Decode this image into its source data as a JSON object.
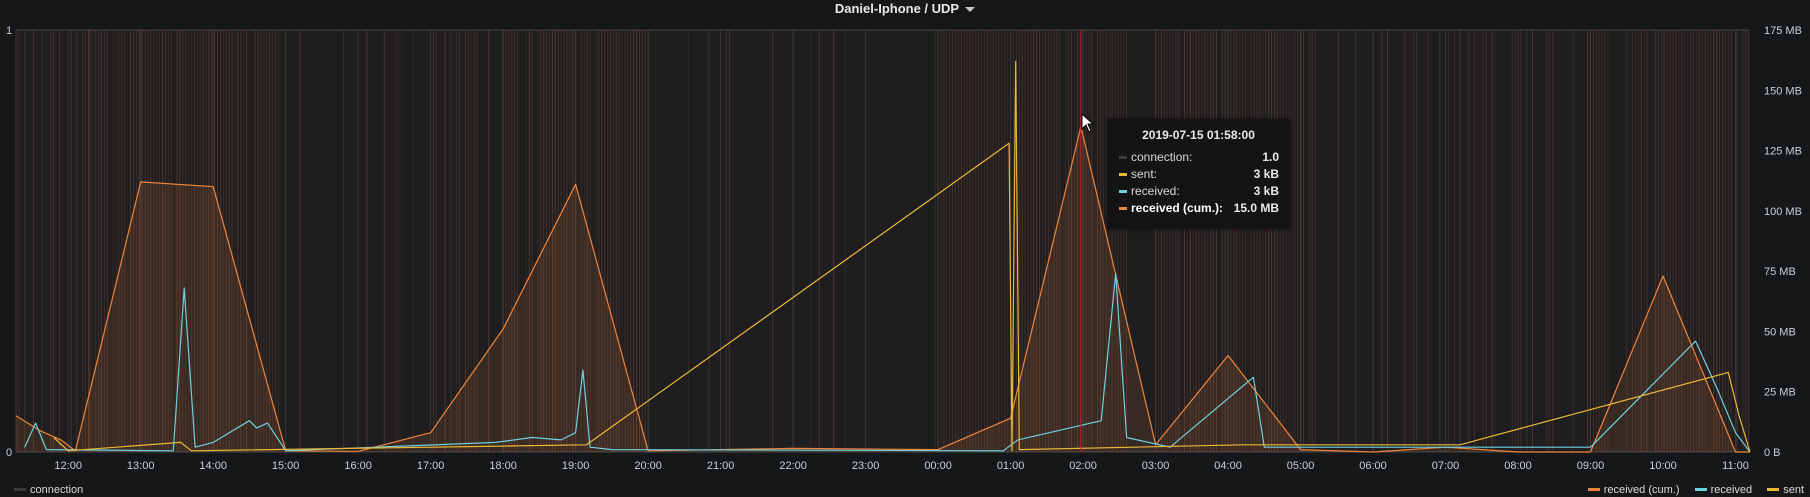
{
  "panel": {
    "title": "Daniel-Iphone / UDP"
  },
  "colors": {
    "connection": "#3a3a3a",
    "sent": "#eab839",
    "received": "#6ed0e0",
    "received_cum": "#ef843c",
    "crosshair": "#c4162a"
  },
  "legend": {
    "left": [
      {
        "name": "connection",
        "color": "#3a3a3a"
      }
    ],
    "right": [
      {
        "name": "received (cum.)",
        "color": "#ef843c"
      },
      {
        "name": "received",
        "color": "#6ed0e0"
      },
      {
        "name": "sent",
        "color": "#eab839"
      }
    ]
  },
  "tooltip": {
    "time": "2019-07-15 01:58:00",
    "rows": [
      {
        "label": "connection:",
        "value": "1.0",
        "color": "#3a3a3a",
        "bold": false
      },
      {
        "label": "sent:",
        "value": "3 kB",
        "color": "#eab839",
        "bold": false
      },
      {
        "label": "received:",
        "value": "3 kB",
        "color": "#6ed0e0",
        "bold": false
      },
      {
        "label": "received (cum.):",
        "value": "15.0 MB",
        "color": "#ef843c",
        "bold": true
      }
    ]
  },
  "chart_data": {
    "type": "line",
    "xlabel": "",
    "ylabel_left": "",
    "ylabel_right": "",
    "x_ticks": [
      "12:00",
      "13:00",
      "14:00",
      "15:00",
      "16:00",
      "17:00",
      "18:00",
      "19:00",
      "20:00",
      "21:00",
      "22:00",
      "23:00",
      "00:00",
      "01:00",
      "02:00",
      "03:00",
      "04:00",
      "05:00",
      "06:00",
      "07:00",
      "08:00",
      "09:00",
      "10:00",
      "11:00"
    ],
    "x_range_hours": [
      11.28,
      35.2
    ],
    "y_left_ticks": [
      "0",
      "1"
    ],
    "y_left_range": [
      0,
      1
    ],
    "y_right_ticks": [
      "0 B",
      "25 MB",
      "50 MB",
      "75 MB",
      "100 MB",
      "125 MB",
      "150 MB",
      "175 MB"
    ],
    "y_right_range_mb": [
      0,
      175
    ],
    "crosshair_hour": 25.97,
    "grid": true,
    "legend_position": "bottom",
    "series": [
      {
        "name": "received (cum.)",
        "axis": "right",
        "unit": "MB",
        "points": [
          [
            11.28,
            15
          ],
          [
            11.6,
            9
          ],
          [
            11.9,
            5
          ],
          [
            12.1,
            0.5
          ],
          [
            13.0,
            112
          ],
          [
            14.0,
            110
          ],
          [
            15.0,
            0.5
          ],
          [
            16.0,
            0.3
          ],
          [
            17.0,
            8
          ],
          [
            18.0,
            51
          ],
          [
            19.0,
            111
          ],
          [
            20.0,
            0.5
          ],
          [
            22.0,
            1.5
          ],
          [
            24.0,
            1
          ],
          [
            25.0,
            14
          ],
          [
            25.97,
            135
          ],
          [
            27.0,
            3
          ],
          [
            28.0,
            40
          ],
          [
            29.0,
            1
          ],
          [
            30.0,
            0
          ],
          [
            31.0,
            2
          ],
          [
            32.0,
            0
          ],
          [
            33.0,
            0
          ],
          [
            34.0,
            73
          ],
          [
            35.0,
            0
          ],
          [
            35.2,
            0
          ]
        ]
      },
      {
        "name": "received",
        "axis": "right",
        "unit": "MB",
        "points": [
          [
            11.4,
            2
          ],
          [
            11.55,
            12
          ],
          [
            11.7,
            1
          ],
          [
            13.45,
            0.5
          ],
          [
            13.6,
            68
          ],
          [
            13.75,
            2
          ],
          [
            14.0,
            4
          ],
          [
            14.5,
            13
          ],
          [
            14.6,
            10
          ],
          [
            14.75,
            12
          ],
          [
            15.0,
            0.5
          ],
          [
            17.9,
            4
          ],
          [
            18.4,
            6
          ],
          [
            18.8,
            5
          ],
          [
            19.0,
            8
          ],
          [
            19.1,
            34
          ],
          [
            19.2,
            2
          ],
          [
            19.5,
            1
          ],
          [
            24.9,
            0.5
          ],
          [
            25.1,
            5
          ],
          [
            26.25,
            13
          ],
          [
            26.45,
            74
          ],
          [
            26.6,
            6
          ],
          [
            27.2,
            2
          ],
          [
            28.35,
            31
          ],
          [
            28.5,
            2
          ],
          [
            33.0,
            2
          ],
          [
            34.45,
            46
          ],
          [
            34.75,
            26
          ],
          [
            35.0,
            8
          ],
          [
            35.2,
            0
          ]
        ]
      },
      {
        "name": "sent",
        "axis": "right",
        "unit": "MB",
        "points": [
          [
            11.8,
            6
          ],
          [
            12.0,
            0.5
          ],
          [
            13.55,
            4
          ],
          [
            13.7,
            0.5
          ],
          [
            19.15,
            3
          ],
          [
            24.98,
            128
          ],
          [
            25.02,
            0.5
          ],
          [
            25.07,
            162
          ],
          [
            25.12,
            1
          ],
          [
            28.2,
            3
          ],
          [
            31.2,
            3
          ],
          [
            34.9,
            33
          ],
          [
            35.05,
            15
          ],
          [
            35.2,
            0
          ]
        ]
      }
    ]
  }
}
